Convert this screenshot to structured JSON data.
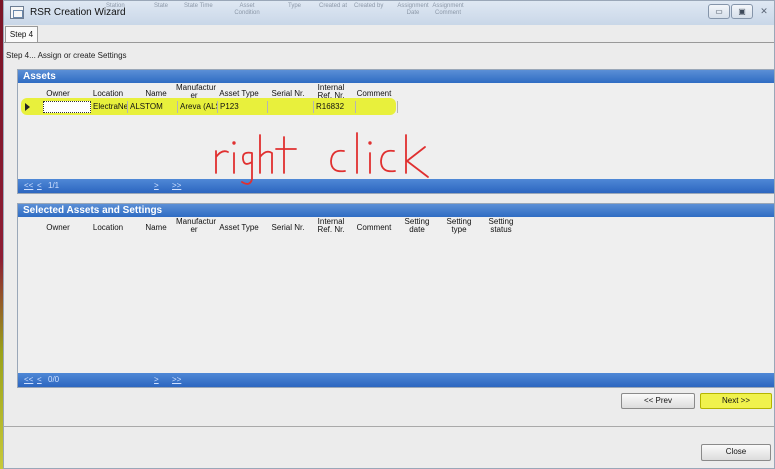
{
  "window": {
    "title": "RSR Creation Wizard",
    "ghost_headers": [
      "Station",
      "State",
      "State Time",
      "Asset Condition",
      "Type",
      "Created at",
      "Created by",
      "Assignment Date",
      "Assignment Comment"
    ],
    "minimize_label": "▭",
    "maximize_label": "▣",
    "close_label": "✕"
  },
  "tab": {
    "label": "Step 4"
  },
  "step_description": "Step 4... Assign or create Settings",
  "assets_panel": {
    "title": "Assets",
    "columns": [
      "Owner",
      "Location",
      "Name",
      "Manufactur er",
      "Asset Type",
      "Serial Nr.",
      "Internal Ref. Nr.",
      "Comment"
    ],
    "rows": [
      {
        "owner": "",
        "location": "ElectraNet/",
        "name": "ALSTOM",
        "manufacturer": "Areva (ALS",
        "asset_type": "P123",
        "serial_nr": "",
        "internal_ref": "R16832",
        "comment": ""
      }
    ],
    "pager": {
      "first": "<<",
      "prev": "<",
      "page": "1/1",
      "next": ">",
      "last": ">>"
    }
  },
  "annotation": {
    "text": "right click",
    "color": "#e03030"
  },
  "selected_panel": {
    "title": "Selected Assets and Settings",
    "columns": [
      "Owner",
      "Location",
      "Name",
      "Manufactur er",
      "Asset Type",
      "Serial Nr.",
      "Internal Ref. Nr.",
      "Comment",
      "Setting date",
      "Setting type",
      "Setting status"
    ],
    "pager": {
      "first": "<<",
      "prev": "<",
      "page": "0/0",
      "next": ">",
      "last": ">>"
    }
  },
  "buttons": {
    "prev": "<< Prev",
    "next": "Next >>",
    "close": "Close"
  },
  "colors": {
    "header_blue": "#2f6cc3",
    "highlight": "#e6f000",
    "accent_red": "#8c1a2e"
  }
}
